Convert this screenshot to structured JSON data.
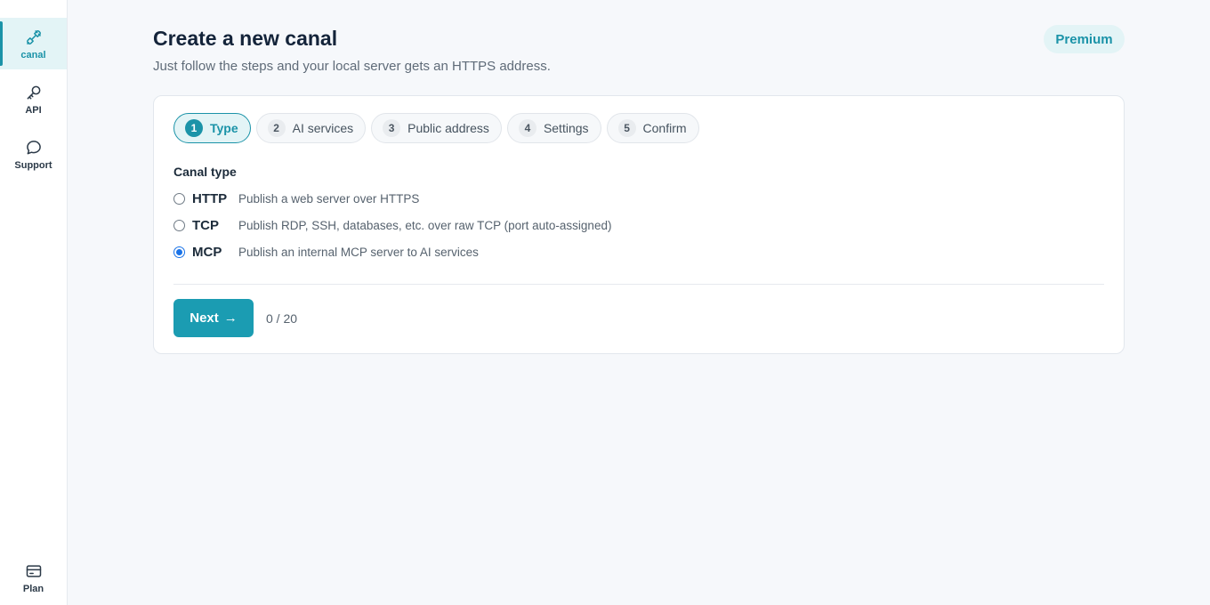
{
  "sidebar": {
    "items": [
      {
        "label": "canal",
        "icon": "link-icon",
        "active": true
      },
      {
        "label": "API",
        "icon": "key-icon"
      },
      {
        "label": "Support",
        "icon": "chat-bubble-icon"
      }
    ],
    "bottom": {
      "label": "Plan",
      "icon": "credit-card-icon"
    }
  },
  "header": {
    "title": "Create a new canal",
    "subtitle": "Just follow the steps and your local server gets an HTTPS address.",
    "badge": "Premium"
  },
  "steps": [
    {
      "num": "1",
      "label": "Type",
      "active": true
    },
    {
      "num": "2",
      "label": "AI services"
    },
    {
      "num": "3",
      "label": "Public address"
    },
    {
      "num": "4",
      "label": "Settings"
    },
    {
      "num": "5",
      "label": "Confirm"
    }
  ],
  "form": {
    "section_label": "Canal type",
    "options": [
      {
        "name": "HTTP",
        "desc": "Publish a web server over HTTPS",
        "checked": false
      },
      {
        "name": "TCP",
        "desc": "Publish RDP, SSH, databases, etc. over raw TCP (port auto-assigned)",
        "checked": false
      },
      {
        "name": "MCP",
        "desc": "Publish an internal MCP server to AI services",
        "checked": true
      }
    ]
  },
  "footer": {
    "next_label": "Next",
    "next_arrow": "→",
    "counter": "0 / 20"
  },
  "colors": {
    "accent": "#1b93a8",
    "accent_bg": "#e3f4f6",
    "radio_checked": "#1a73e8"
  }
}
